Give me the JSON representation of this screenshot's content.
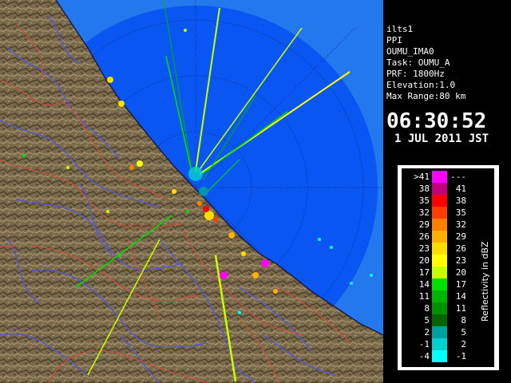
{
  "info": {
    "lines": [
      "ilts1",
      "PPI",
      "OUMU_IMA0",
      "Task: OUMU_A",
      "PRF: 1800Hz",
      "Elevation:1.0",
      "Max Range:80 km"
    ],
    "time": "06:30:52",
    "date": "1 JUL 2011 JST"
  },
  "legend": {
    "title": "Reflectivity in dBZ",
    "rows": [
      {
        "left": ">41",
        "right": "---",
        "color": "#ff00ff"
      },
      {
        "left": "38",
        "right": "41",
        "color": "#c0007f"
      },
      {
        "left": "35",
        "right": "38",
        "color": "#ff0000"
      },
      {
        "left": "32",
        "right": "35",
        "color": "#ff3c00"
      },
      {
        "left": "29",
        "right": "32",
        "color": "#ff8000"
      },
      {
        "left": "26",
        "right": "29",
        "color": "#ffb000"
      },
      {
        "left": "23",
        "right": "26",
        "color": "#ffdc00"
      },
      {
        "left": "20",
        "right": "23",
        "color": "#ffff00"
      },
      {
        "left": "17",
        "right": "20",
        "color": "#c8ff00"
      },
      {
        "left": "14",
        "right": "17",
        "color": "#00e000"
      },
      {
        "left": "11",
        "right": "14",
        "color": "#00b400"
      },
      {
        "left": "8",
        "right": "11",
        "color": "#009000"
      },
      {
        "left": "5",
        "right": "8",
        "color": "#006400"
      },
      {
        "left": "2",
        "right": "5",
        "color": "#00a0a0"
      },
      {
        "left": "-1",
        "right": "2",
        "color": "#00d0d0"
      },
      {
        "left": "-4",
        "right": "-1",
        "color": "#00ffff"
      }
    ]
  },
  "colors": {
    "range_outer": "#2478ee",
    "range_inner": "#0a56f2",
    "terrain": "#7a6a4c",
    "rivers": "#5058d8",
    "borders": "#c8503c"
  }
}
